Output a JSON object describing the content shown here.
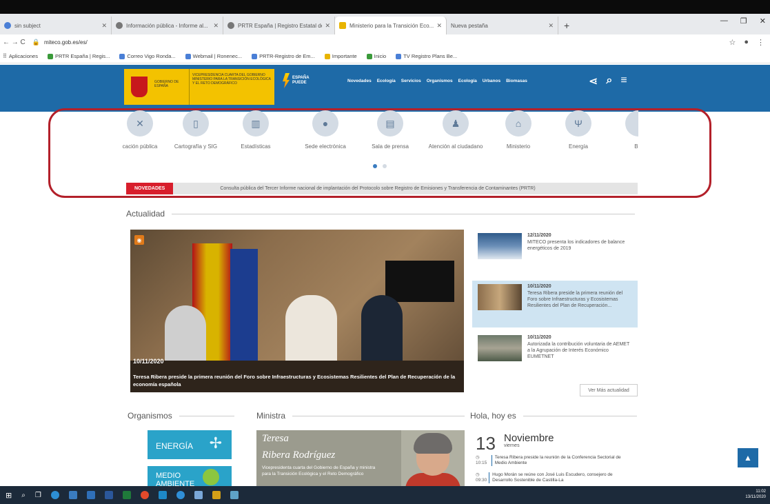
{
  "browser": {
    "tabs": [
      {
        "title": "sin subject",
        "icon": "mail-icon",
        "active": false
      },
      {
        "title": "Información pública - Informe al...",
        "icon": "globe-icon",
        "active": false
      },
      {
        "title": "PRTR España | Registro Estatal de...",
        "icon": "chart-icon",
        "active": false
      },
      {
        "title": "Ministerio para la Transición Eco...",
        "icon": "gov-icon",
        "active": true
      },
      {
        "title": "Nueva pestaña",
        "icon": "newtab-icon",
        "active": false
      }
    ],
    "new_tab_label": "+",
    "url": "miteco.gob.es/es/",
    "nav_symbols": "←  →  C",
    "bookmarks": [
      "Aplicaciones",
      "PRTR España | Regis...",
      "Correo Vigo Ronda...",
      "Webmail | Ronenec...",
      "PRTR-Registro de Em...",
      "Importante",
      "Inicio",
      "TV Registro Plans Be..."
    ]
  },
  "site": {
    "logo_left": "GOBIERNO DE ESPAÑA",
    "logo_right": "VICEPRESIDENCIA CUARTA DEL GOBIERNO MINISTERIO PARA LA TRANSICIÓN ECOLÓGICA Y EL RETO DEMOGRÁFICO",
    "espana_puede": "ESPAÑA PUEDE",
    "nav": [
      "Novedades",
      "Ecología",
      "Servicios",
      "Organismos",
      "Ecología",
      "Urbanos",
      "Biomasas"
    ]
  },
  "carousel": {
    "items": [
      {
        "label": "cación pública",
        "icon": "participation-icon"
      },
      {
        "label": "Cartografía y SIG",
        "icon": "map-icon"
      },
      {
        "label": "Estadísticas",
        "icon": "stats-icon"
      },
      {
        "label": "Sede electrónica",
        "icon": "sede-icon"
      },
      {
        "label": "Sala de prensa",
        "icon": "press-icon"
      },
      {
        "label": "Atención al ciudadano",
        "icon": "person-icon"
      },
      {
        "label": "Ministerio",
        "icon": "building-icon"
      },
      {
        "label": "Energía",
        "icon": "energy-icon"
      },
      {
        "label": "Bio",
        "icon": "bio-icon"
      }
    ]
  },
  "ticker": {
    "tag": "NOVEDADES",
    "message": "Consulta pública del Tercer Informe nacional de implantación del Protocolo sobre Registro de Emisiones y Transferencia de Contaminantes (PRTR)"
  },
  "actualidad": {
    "title": "Actualidad",
    "hero_date": "10/11/2020",
    "hero_caption": "Teresa Ribera preside la primera reunión del Foro sobre Infraestructuras y Ecosistemas Resilientes del Plan de Recuperación de la economía española",
    "news": [
      {
        "date": "12/11/2020",
        "text": "MITECO presenta los indicadores de balance energéticos de 2019"
      },
      {
        "date": "10/11/2020",
        "text": "Teresa Ribera preside la primera reunión del Foro sobre Infraestructuras y Ecosistemas Resilientes del Plan de Recuperación..."
      },
      {
        "date": "10/11/2020",
        "text": "Autorizada la contribución voluntaria de AEMET a la Agrupación de Interés Económico EUMETNET"
      }
    ],
    "more_label": "Ver Más actualidad"
  },
  "organismos": {
    "title": "Organismos",
    "items": [
      {
        "label": "ENERGÍA",
        "color": "#2aa3c9"
      },
      {
        "label": "MEDIO AMBIENTE",
        "color": "#2aa3c9"
      }
    ]
  },
  "ministra": {
    "title": "Ministra",
    "name_first": "Teresa",
    "name_last": "Ribera Rodríguez",
    "description": "Vicepresidenta cuarta del Gobierno de España y ministra para la Transición Ecológica y el Reto Demográfico"
  },
  "hoy": {
    "title": "Hola, hoy es",
    "day": "13",
    "month": "Noviembre",
    "weekday": "viernes",
    "agenda": [
      {
        "time": "10:15",
        "text": "Teresa Ribera preside la reunión de la Conferencia Sectorial de Medio Ambiente"
      },
      {
        "time": "09:30",
        "text": "Hugo Morán se reúne con José Luis Escudero, consejero de Desarrollo Sostenible de Castilla-La"
      }
    ]
  },
  "taskbar": {
    "time": "11:02",
    "date": "13/11/2020"
  },
  "colors": {
    "header_blue": "#1e6aa7",
    "novedades_red": "#d81e2c",
    "highlight_red": "#b3202a",
    "gov_yellow": "#f3c200"
  }
}
